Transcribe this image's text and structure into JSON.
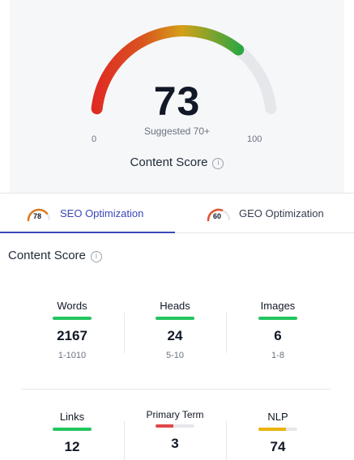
{
  "overall": {
    "score": "73",
    "score_value": 73,
    "suggested": "Suggested 70+",
    "min_label": "0",
    "max_label": "100",
    "title": "Content Score"
  },
  "tabs": [
    {
      "label": "SEO Optimization",
      "score": "78",
      "score_value": 78,
      "active": true
    },
    {
      "label": "GEO Optimization",
      "score": "60",
      "score_value": 60,
      "active": false
    }
  ],
  "section": {
    "title": "Content Score"
  },
  "info_icon": {
    "glyph": "i"
  },
  "metrics": [
    {
      "label": "Words",
      "value": "2167",
      "range": "1-1010",
      "bar_fill": 1.0,
      "bar_color": "#22c55e"
    },
    {
      "label": "Heads",
      "value": "24",
      "range": "5-10",
      "bar_fill": 1.0,
      "bar_color": "#22c55e"
    },
    {
      "label": "Images",
      "value": "6",
      "range": "1-8",
      "bar_fill": 1.0,
      "bar_color": "#22c55e"
    },
    {
      "label": "Links",
      "value": "12",
      "range": "",
      "bar_fill": 1.0,
      "bar_color": "#22c55e"
    },
    {
      "label": "Primary Term",
      "value": "3",
      "range": "",
      "bar_fill": 0.45,
      "bar_color": "#e04848"
    },
    {
      "label": "NLP",
      "value": "74",
      "range": "",
      "bar_fill": 0.7,
      "bar_color": "#eab308"
    }
  ],
  "colors": {
    "accent": "#3b46b8",
    "gauge_low": "#e02424",
    "gauge_mid": "#d4a017",
    "gauge_high": "#22a745",
    "gauge_track": "#e5e7eb"
  }
}
